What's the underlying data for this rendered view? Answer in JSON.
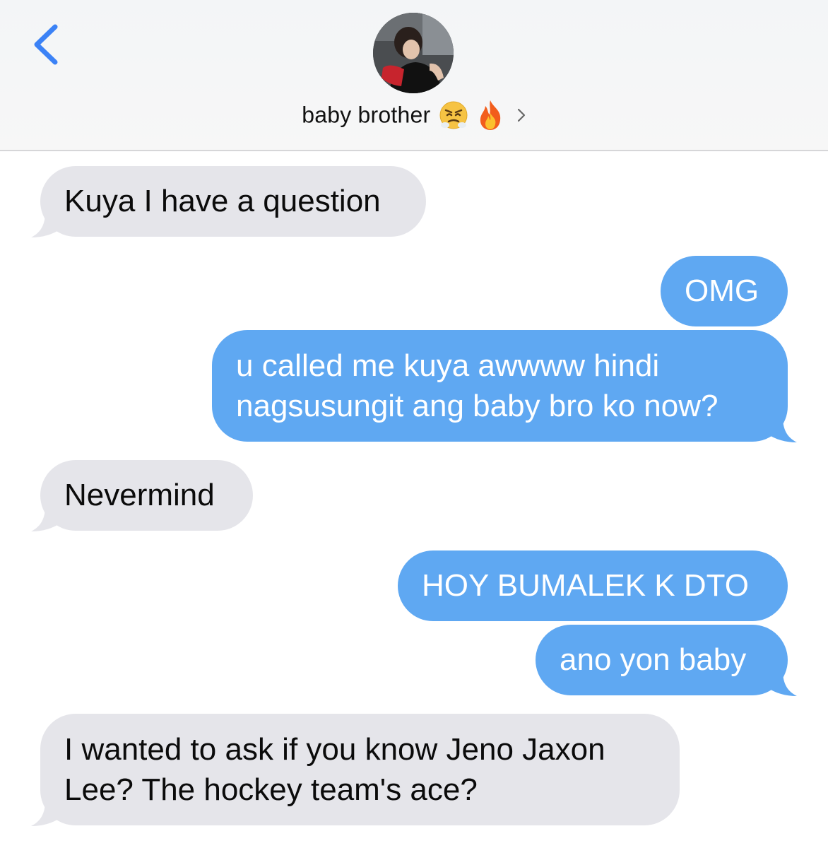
{
  "header": {
    "contact_name": "baby brother",
    "emoji_1": "😤",
    "emoji_2": "🔥"
  },
  "messages": [
    {
      "side": "received",
      "text": "Kuya I have a question"
    },
    {
      "side": "sent",
      "text": "OMG"
    },
    {
      "side": "sent",
      "line1": "u called me kuya awwww hindi",
      "line2": "nagsusungit ang baby bro ko now?"
    },
    {
      "side": "received",
      "text": "Nevermind"
    },
    {
      "side": "sent",
      "text": "HOY BUMALEK K DTO"
    },
    {
      "side": "sent",
      "text": "ano yon baby"
    },
    {
      "side": "received",
      "line1": "I wanted to ask if you know Jeno Jaxon",
      "line2": "Lee? The hockey team's ace?"
    }
  ],
  "colors": {
    "sent_bubble": "#5fa8f2",
    "received_bubble": "#e5e5ea",
    "accent": "#3b82f6"
  }
}
